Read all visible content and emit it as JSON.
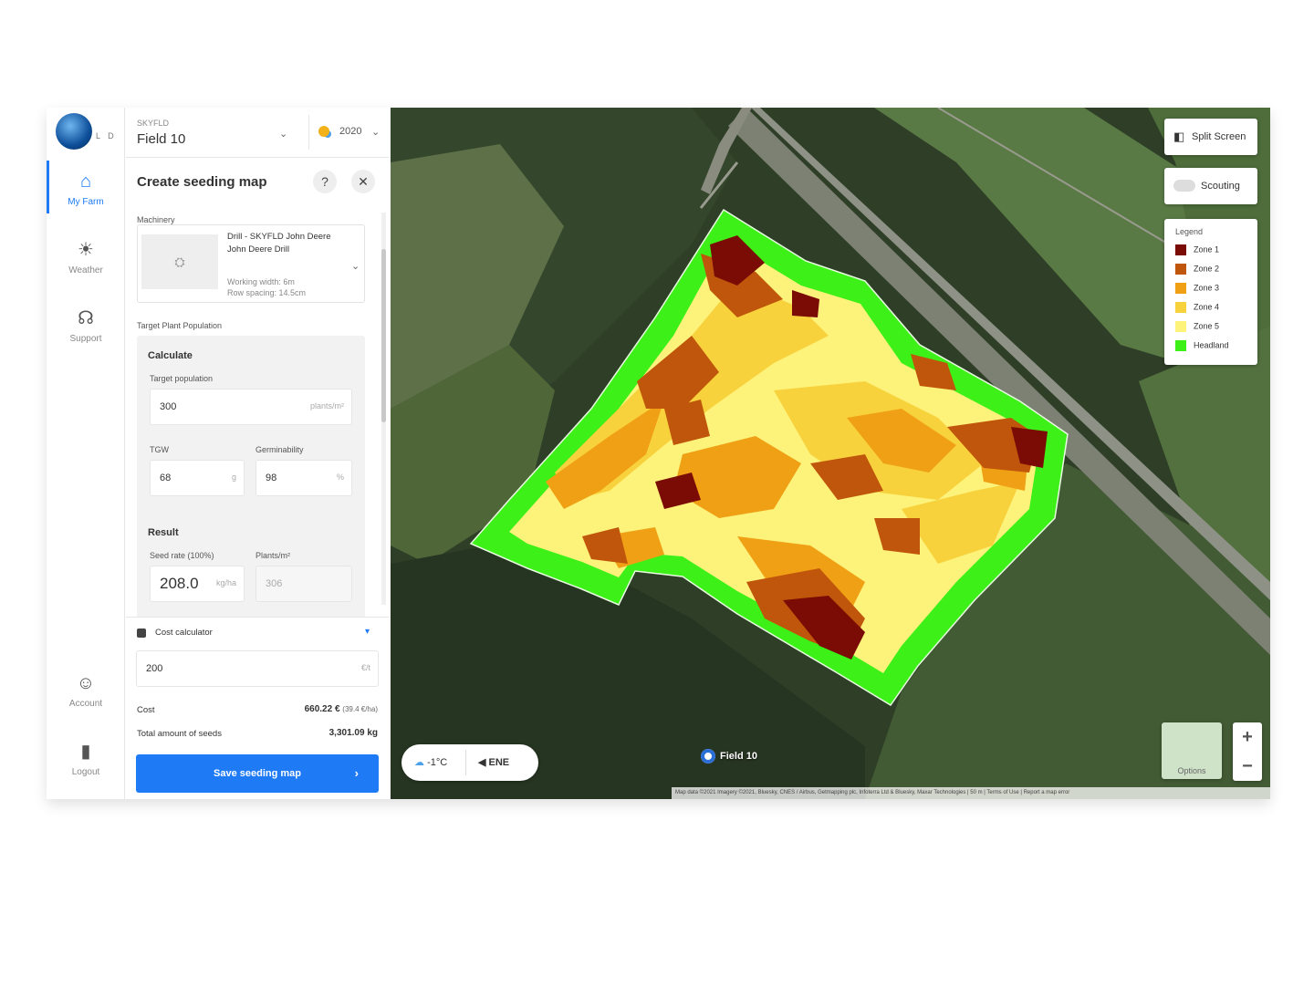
{
  "nav": {
    "logo_letters": "L D",
    "items": [
      {
        "label": "My Farm",
        "icon": "home-icon"
      },
      {
        "label": "Weather",
        "icon": "sun-icon"
      },
      {
        "label": "Support",
        "icon": "headset-icon"
      },
      {
        "label": "Account",
        "icon": "account-icon"
      },
      {
        "label": "Logout",
        "icon": "logout-icon"
      }
    ]
  },
  "header": {
    "farm_label": "SKYFLD",
    "field_name": "Field 10",
    "year": "2020"
  },
  "panel": {
    "title": "Create seeding map",
    "machinery_label": "Machinery",
    "machinery_name": "Drill - SKYFLD John Deere John Deere Drill",
    "machinery_width": "Working width: 6m",
    "machinery_spacing": "Row spacing: 14.5cm",
    "target_label": "Target Plant Population",
    "calculate_label": "Calculate",
    "target_population_label": "Target population",
    "target_population_value": "300",
    "target_population_unit": "plants/m²",
    "tgw_label": "TGW",
    "tgw_value": "68",
    "tgw_unit": "g",
    "germ_label": "Germinability",
    "germ_value": "98",
    "germ_unit": "%",
    "result_label": "Result",
    "seed_rate_label": "Seed rate (100%)",
    "seed_rate_value": "208.0",
    "seed_rate_unit": "kg/ha",
    "plants_label": "Plants/m²",
    "plants_value": "306"
  },
  "cost": {
    "title": "Cost calculator",
    "price_value": "200",
    "price_unit": "€/t",
    "cost_label": "Cost",
    "cost_value": "660.22 €",
    "cost_per_ha": "(39.4 €/ha)",
    "seeds_label": "Total amount of seeds",
    "seeds_value": "3,301.09 kg",
    "save_label": "Save seeding map"
  },
  "map": {
    "split_label": "Split Screen",
    "scouting_label": "Scouting",
    "legend_title": "Legend",
    "legend": [
      {
        "label": "Zone 1",
        "color": "#7a0c05"
      },
      {
        "label": "Zone 2",
        "color": "#c0560b"
      },
      {
        "label": "Zone 3",
        "color": "#f0a014"
      },
      {
        "label": "Zone 4",
        "color": "#f8d23c"
      },
      {
        "label": "Zone 5",
        "color": "#fdf27a"
      },
      {
        "label": "Headland",
        "color": "#3cf018"
      }
    ],
    "temperature": "-1°C",
    "wind": "ENE",
    "field_tag": "Field 10",
    "options_label": "Options",
    "attribution": "Map data ©2021 Imagery ©2021, Bluesky, CNES / Airbus, Getmapping plc, Infoterra Ltd & Bluesky, Maxar Technologies | 50 m | Terms of Use | Report a map error"
  }
}
